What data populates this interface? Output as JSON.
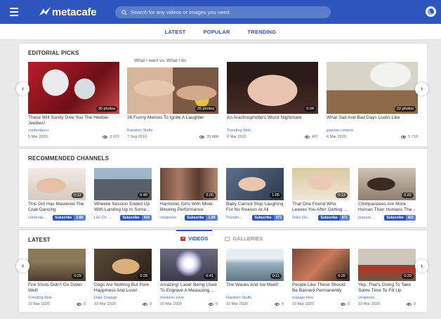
{
  "header": {
    "logo_text": "metacafe",
    "search_placeholder": "Search for any videos or images you need"
  },
  "nav": [
    "LATEST",
    "POPULAR",
    "TRENDING"
  ],
  "editorial": {
    "title": "EDITORIAL PICKS",
    "partial_title": "What I want vs. What I do",
    "cards": [
      {
        "title": "These Will Surely Give You The Heebie-Jeebies!",
        "channel": "contentguru",
        "date": "5 Mar 2020",
        "views": "3 672",
        "badge": "30 photos"
      },
      {
        "title": "26 Funny Memes To Ignite A Laughter",
        "channel": "Random Stuffs",
        "date": "7 Sep 2016",
        "views": "35 886",
        "badge": "26 photos"
      },
      {
        "title": "An Arachnophobe's Worst Nightmare",
        "channel": "Trending Web",
        "date": "8 Mar 2020",
        "views": "407",
        "badge": "0:04"
      },
      {
        "title": "What Sad And Bad Days Looks Like",
        "channel": "popular content",
        "date": "6 Mar 2020",
        "views": "5 710",
        "badge": "22 photos"
      }
    ]
  },
  "channels": {
    "title": "RECOMMENDED CHANNELS",
    "subscribe_label": "Subscribe",
    "cards": [
      {
        "title": "This Girl Has Mastered The Crab Dancing",
        "channel": "contentg...",
        "duration": "0:12",
        "subs": "2.8K"
      },
      {
        "title": "Wheelie Session Ended Up With Landing Up In Some...",
        "channel": "Life On ...",
        "duration": "0:40",
        "subs": "416"
      },
      {
        "title": "Harmonic Girls With Mind-Blowing Performance",
        "channel": "viralposts",
        "duration": "2:20",
        "subs": "1.3K"
      },
      {
        "title": "Baby Cannot Stop Laughing For No Reason At All",
        "channel": "Trendin...",
        "duration": "1:05",
        "subs": "473"
      },
      {
        "title": "That One Friend Who Leaves You After Getting ...",
        "channel": "Daily Do...",
        "duration": "0:13",
        "subs": "471"
      },
      {
        "title": "Chimpanzees Are More Human Than Humans The...",
        "channel": "popular ...",
        "duration": "0:22",
        "subs": "421"
      }
    ]
  },
  "latest": {
    "title": "LATEST",
    "tabs": [
      "VIDEOS",
      "GALLERIES"
    ],
    "cards": [
      {
        "title": "Fire Shots Didn't Go Down Well!",
        "channel": "Trending Web",
        "date": "10 Mar 2020",
        "views": "0",
        "duration": "0:29"
      },
      {
        "title": "Dogs Are Nothing But Pure Happiness And Love!",
        "channel": "Daily Dosage",
        "date": "10 Mar 2020",
        "views": "0",
        "duration": "0:28"
      },
      {
        "title": "Amazing! Laser Being Used To Engrave A Measuring ...",
        "channel": "mixtures zone",
        "date": "10 Mar 2020",
        "views": "0",
        "duration": "0:41"
      },
      {
        "title": "The Waves And Ice Meet!",
        "channel": "Random Stuffs",
        "date": "10 Mar 2020",
        "views": "0",
        "duration": "0:11"
      },
      {
        "title": "People Like These Should Be Banned Permanently",
        "channel": "engage time",
        "date": "10 Mar 2020",
        "views": "0",
        "duration": "0:26"
      },
      {
        "title": "Yep, That's Going To Take Some Time To Fill Up",
        "channel": "viralposts",
        "date": "10 Mar 2020",
        "views": "0",
        "duration": "0:20"
      }
    ]
  }
}
